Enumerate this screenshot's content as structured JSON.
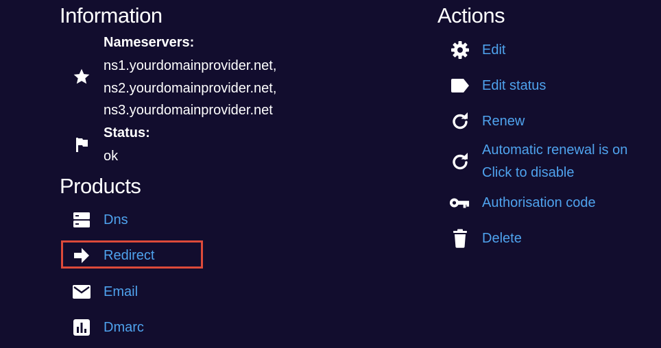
{
  "information": {
    "title": "Information",
    "nameservers_label": "Nameservers:",
    "nameservers": [
      "ns1.yourdomainprovider.net,",
      "ns2.yourdomainprovider.net,",
      "ns3.yourdomainprovider.net"
    ],
    "status_label": "Status:",
    "status_value": "ok"
  },
  "products": {
    "title": "Products",
    "items": [
      {
        "label": "Dns",
        "icon": "server-icon"
      },
      {
        "label": "Redirect",
        "icon": "arrow-right-icon"
      },
      {
        "label": "Email",
        "icon": "envelope-icon"
      },
      {
        "label": "Dmarc",
        "icon": "chart-icon"
      }
    ]
  },
  "actions": {
    "title": "Actions",
    "items": [
      {
        "label": "Edit",
        "icon": "gear-icon"
      },
      {
        "label": "Edit status",
        "icon": "tag-icon"
      },
      {
        "label": "Renew",
        "icon": "refresh-icon"
      },
      {
        "label_line1": "Automatic renewal is on",
        "label_line2": "Click to disable",
        "icon": "refresh-icon"
      },
      {
        "label": "Authorisation code",
        "icon": "key-icon"
      },
      {
        "label": "Delete",
        "icon": "trash-icon"
      }
    ]
  },
  "colors": {
    "background": "#120d2e",
    "link": "#4fa3ee",
    "text": "#ffffff",
    "highlight": "#dd4a3a"
  }
}
